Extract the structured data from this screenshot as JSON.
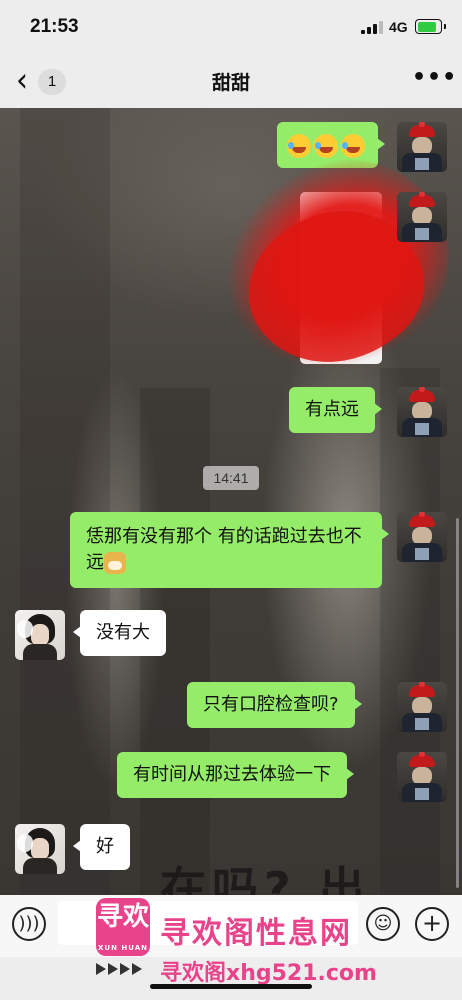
{
  "status_bar": {
    "time": "21:53",
    "network": "4G"
  },
  "nav": {
    "unread_count": "1",
    "title": "甜甜",
    "more_label": "•••"
  },
  "chat": {
    "messages": [
      {
        "from": "me",
        "type": "emoji",
        "emoji_names": [
          "laugh-cry-emoji",
          "laugh-cry-emoji",
          "laugh-cry-emoji"
        ]
      },
      {
        "from": "me",
        "type": "image",
        "note": "redacted-image"
      },
      {
        "from": "me",
        "type": "text",
        "text": "有点远"
      },
      {
        "type": "time",
        "text": "14:41"
      },
      {
        "from": "me",
        "type": "text",
        "text": "恁那有没有那个 有的话跑过去也不远",
        "trailing_emoji": "doge-emoji"
      },
      {
        "from": "her",
        "type": "text",
        "text": "没有大"
      },
      {
        "from": "me",
        "type": "text",
        "text": "只有口腔检查呗?"
      },
      {
        "from": "me",
        "type": "text",
        "text": "有时间从那过去体验一下"
      },
      {
        "from": "her",
        "type": "text",
        "text": "好"
      }
    ],
    "background_text": "在吗? 出"
  },
  "input_bar": {
    "voice_icon": "voice-icon",
    "emoji_icon": "emoji-icon",
    "plus_icon": "plus-icon",
    "input_value": ""
  },
  "watermark": {
    "logo_main": "寻欢",
    "logo_sub": "XUN HUAN",
    "title": "寻欢阁性息网",
    "url": "寻欢阁xhg521.com"
  },
  "colors": {
    "me_bubble": "#95ec69",
    "her_bubble": "#ffffff",
    "watermark": "#e8438b"
  }
}
